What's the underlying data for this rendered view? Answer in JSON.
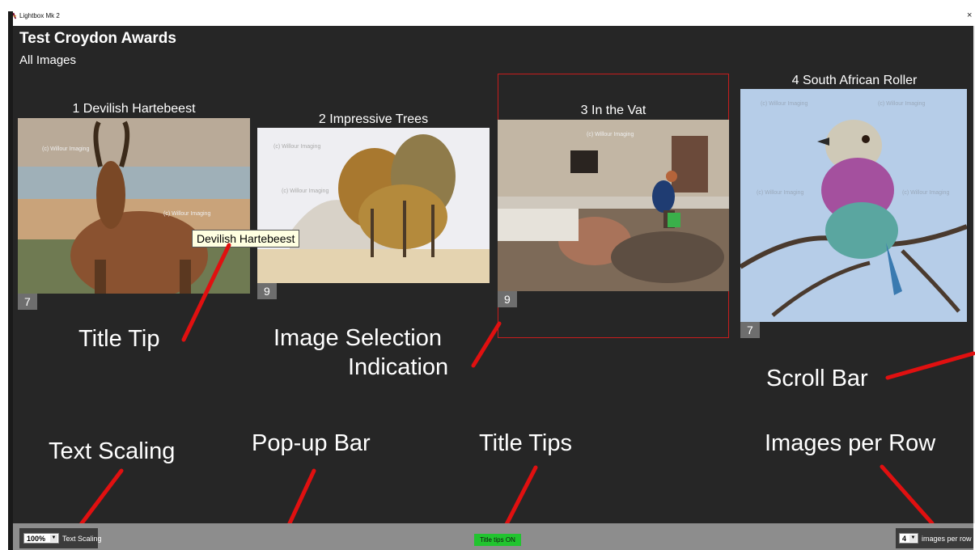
{
  "window": {
    "app_name": "Lightbox Mk 2",
    "close_glyph": "×"
  },
  "header": {
    "collection_title": "Test Croydon Awards",
    "subtitle": "All Images"
  },
  "images": [
    {
      "number_title": "1 Devilish Hartebeest",
      "badge": "7"
    },
    {
      "number_title": "2 Impressive Trees",
      "badge": "9"
    },
    {
      "number_title": "3 In the Vat",
      "badge": "9",
      "selected": true
    },
    {
      "number_title": "4 South African Roller",
      "badge": "7"
    }
  ],
  "tooltip": {
    "text": "Devilish Hartebeest"
  },
  "watermark_text": "(c) Willour Imaging",
  "callouts": {
    "title_tip": "Title Tip",
    "image_selection_line1": "Image Selection",
    "image_selection_line2": "Indication",
    "scroll_bar": "Scroll Bar",
    "text_scaling": "Text Scaling",
    "popup_bar": "Pop-up Bar",
    "title_tips": "Title Tips",
    "images_per_row": "Images per Row"
  },
  "bottom_bar": {
    "text_scaling_value": "100%",
    "text_scaling_label": "Text Scaling",
    "title_tips_button": "Title tips ON",
    "images_per_row_value": "4",
    "images_per_row_label": "images per row"
  },
  "colors": {
    "background": "#262626",
    "selection_border": "#c81d1d",
    "annotation_arrow": "#e01010",
    "tips_on": "#21c42f",
    "bottom_bar": "#8d8d8d"
  }
}
